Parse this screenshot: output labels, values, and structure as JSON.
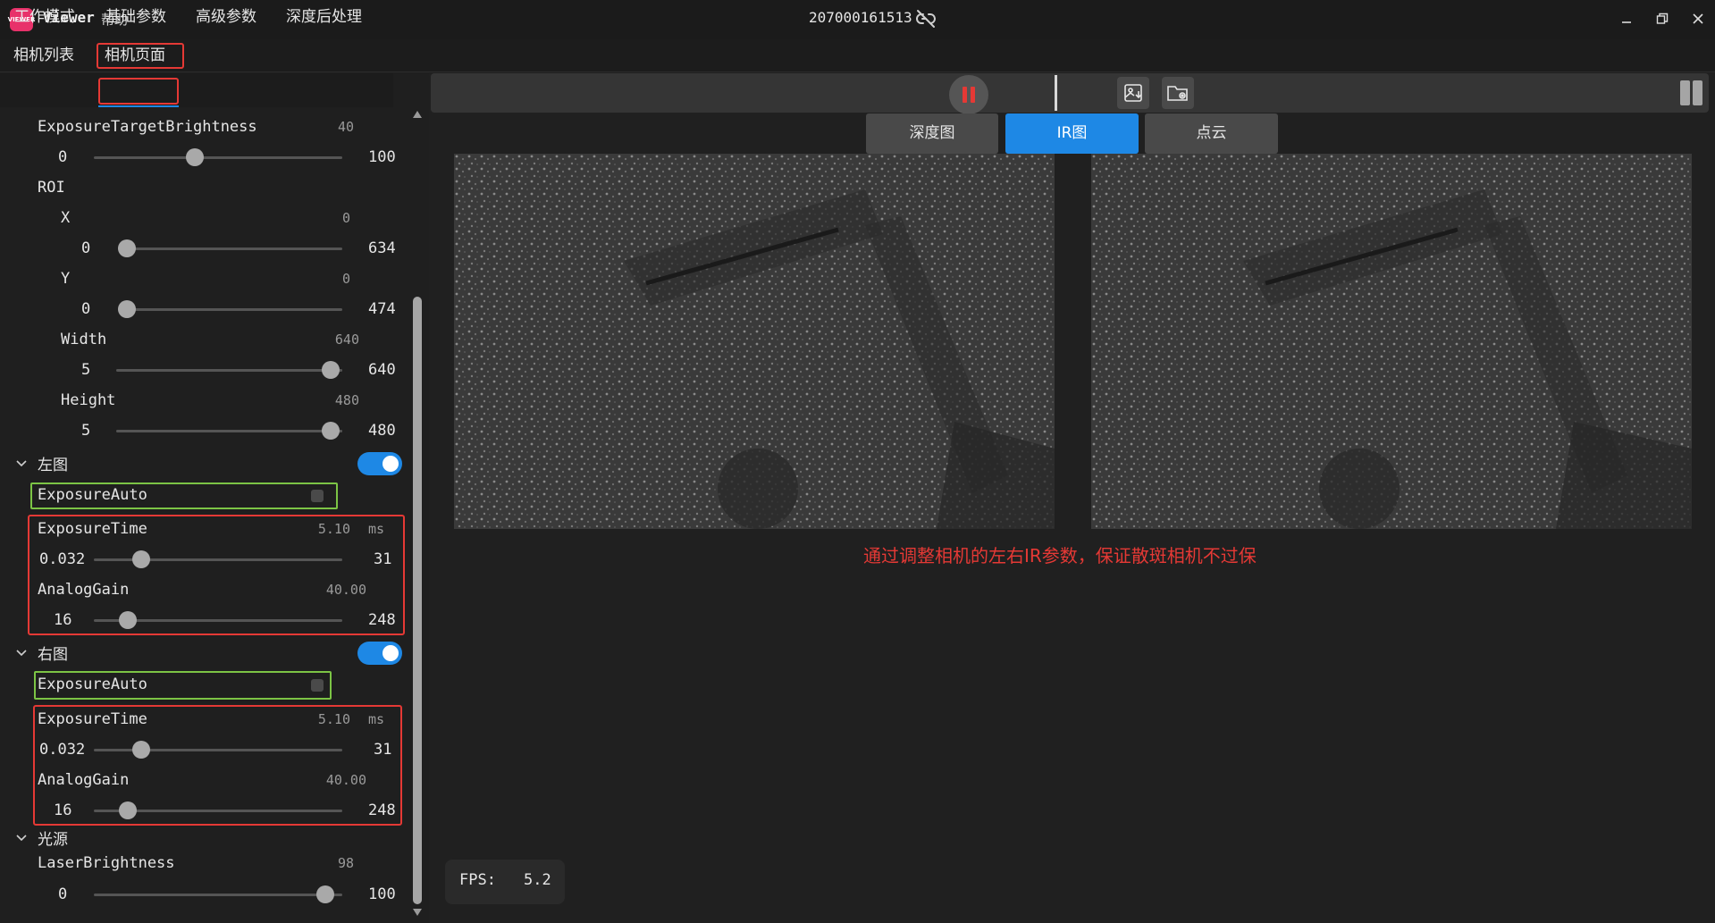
{
  "titlebar": {
    "logo_text": "VIEWER",
    "app_name": "Viewer",
    "help": "帮助",
    "serial": "207000161513"
  },
  "top_tabs": [
    {
      "label": "相机列表"
    },
    {
      "label": "相机页面"
    }
  ],
  "sub_tabs": [
    {
      "label": "工作模式"
    },
    {
      "label": "基础参数"
    },
    {
      "label": "高级参数"
    },
    {
      "label": "深度后处理"
    }
  ],
  "params": {
    "exposure_target": {
      "label": "ExposureTargetBrightness",
      "value": "40",
      "min": "0",
      "max": "100",
      "fraction": 0.4
    },
    "roi": {
      "label": "ROI",
      "x": {
        "label": "X",
        "value": "0",
        "min": "0",
        "max": "634",
        "fraction": 0.0
      },
      "y": {
        "label": "Y",
        "value": "0",
        "min": "0",
        "max": "474",
        "fraction": 0.0
      },
      "width": {
        "label": "Width",
        "value": "640",
        "min": "5",
        "max": "640",
        "fraction": 1.0
      },
      "height": {
        "label": "Height",
        "value": "480",
        "min": "5",
        "max": "480",
        "fraction": 1.0
      }
    },
    "left": {
      "label": "左图",
      "exposure_auto": "ExposureAuto",
      "exposure_time": {
        "label": "ExposureTime",
        "value": "5.10",
        "unit": "ms",
        "min": "0.032",
        "max": "31",
        "fraction": 0.16
      },
      "analog_gain": {
        "label": "AnalogGain",
        "value": "40.00",
        "min": "16",
        "max": "248",
        "fraction": 0.1
      }
    },
    "right": {
      "label": "右图",
      "exposure_auto": "ExposureAuto",
      "exposure_time": {
        "label": "ExposureTime",
        "value": "5.10",
        "unit": "ms",
        "min": "0.032",
        "max": "31",
        "fraction": 0.16
      },
      "analog_gain": {
        "label": "AnalogGain",
        "value": "40.00",
        "min": "16",
        "max": "248",
        "fraction": 0.1
      }
    },
    "light": {
      "label": "光源",
      "laser": {
        "label": "LaserBrightness",
        "value": "98",
        "min": "0",
        "max": "100",
        "fraction": 0.98
      }
    }
  },
  "view_tabs": [
    {
      "label": "深度图"
    },
    {
      "label": "IR图"
    },
    {
      "label": "点云"
    }
  ],
  "annotation": "通过调整相机的左右IR参数，保证散斑相机不过保",
  "fps": {
    "label": "FPS:",
    "value": "5.2"
  },
  "colors": {
    "accent": "#1e88e5",
    "highlight_red": "#e53935",
    "highlight_green": "#7cc445"
  },
  "icons": [
    "link-off-icon",
    "minimize-icon",
    "restore-icon",
    "close-icon",
    "pause-icon",
    "save-image-icon",
    "folder-settings-icon",
    "split-view-icon",
    "chevron-down-icon"
  ]
}
